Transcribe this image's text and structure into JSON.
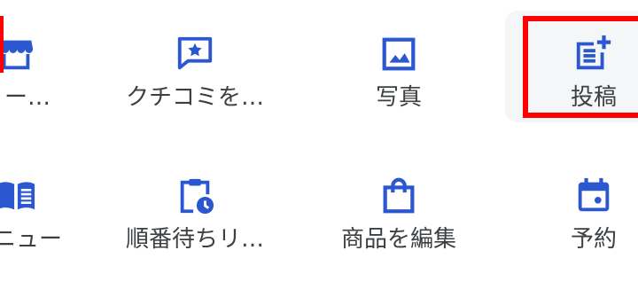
{
  "colors": {
    "icon": "#2b57d0",
    "label": "#3c4043",
    "highlight_bg": "#f4f6f8",
    "annotation": "#ff0000"
  },
  "row1": [
    {
      "label": "ィー…",
      "icon": "storefront-icon"
    },
    {
      "label": "クチコミを…",
      "icon": "review-star-icon"
    },
    {
      "label": "写真",
      "icon": "photo-icon"
    },
    {
      "label": "投稿",
      "icon": "add-post-icon"
    }
  ],
  "row2": [
    {
      "label": "メニュー",
      "icon": "menu-book-icon"
    },
    {
      "label": "順番待ちリ…",
      "icon": "waitlist-clipboard-icon"
    },
    {
      "label": "商品を編集",
      "icon": "shopping-bag-icon"
    },
    {
      "label": "予約",
      "icon": "calendar-event-icon"
    }
  ]
}
